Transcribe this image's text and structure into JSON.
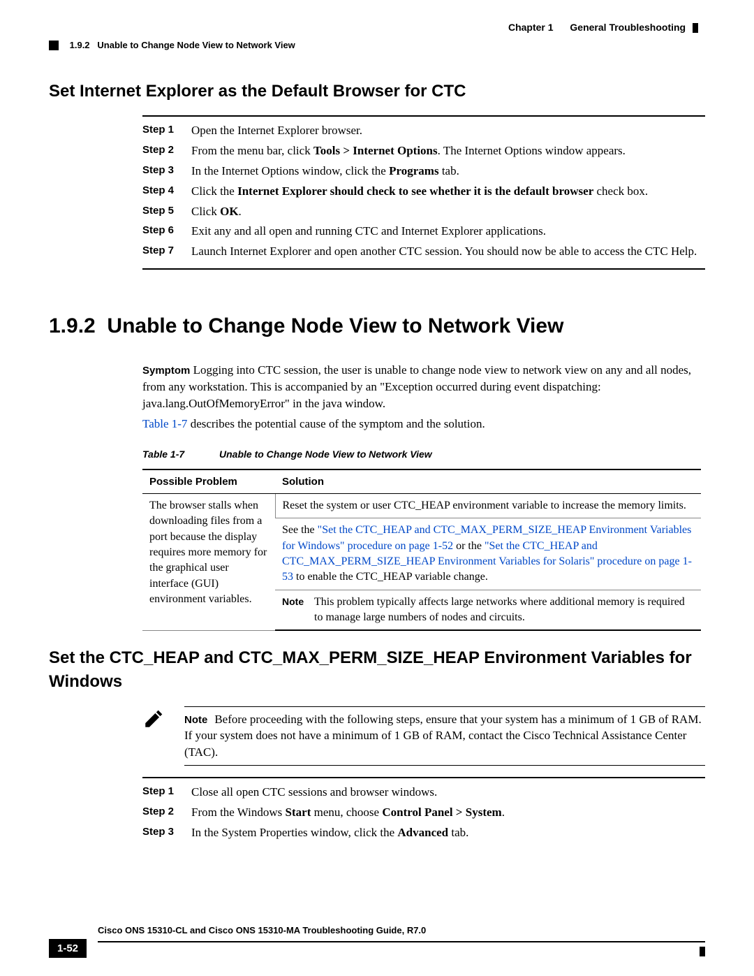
{
  "header": {
    "chapter": "Chapter 1",
    "section": "General Troubleshooting",
    "subsec_num": "1.9.2",
    "subsec_title": "Unable to Change Node View to Network View"
  },
  "h2_first": "Set Internet Explorer as the Default Browser for CTC",
  "steps1": {
    "s1": {
      "label": "Step 1",
      "text": "Open the Internet Explorer browser."
    },
    "s2": {
      "label": "Step 2",
      "a": "From the menu bar, click ",
      "b": "Tools > Internet Options",
      "c": ". The Internet Options window appears."
    },
    "s3": {
      "label": "Step 3",
      "a": "In the Internet Options window, click the ",
      "b": "Programs",
      "c": " tab."
    },
    "s4": {
      "label": "Step 4",
      "a": "Click the ",
      "b": "Internet Explorer should check to see whether it is the default browser",
      "c": " check box."
    },
    "s5": {
      "label": "Step 5",
      "a": "Click ",
      "b": "OK",
      "c": "."
    },
    "s6": {
      "label": "Step 6",
      "text": "Exit any and all open and running CTC and Internet Explorer applications."
    },
    "s7": {
      "label": "Step 7",
      "text": "Launch Internet Explorer and open another CTC session. You should now be able to access the CTC Help."
    }
  },
  "big_section": {
    "num": "1.9.2",
    "title": "Unable to Change Node View to Network View"
  },
  "symptom": {
    "label": "Symptom",
    "text": "   Logging into CTC session, the user is unable to change node view to network view on any and all nodes, from any workstation. This is accompanied by an \"Exception occurred during event dispatching: java.lang.OutOfMemoryError\" in the java window."
  },
  "desc_link": "Table 1-7",
  "desc_after": " describes the potential cause of the symptom and the solution.",
  "table": {
    "num": "Table 1-7",
    "title": "Unable to Change Node View to Network View",
    "h1": "Possible Problem",
    "h2": "Solution",
    "problem": "The browser stalls when downloading files from a port because the display requires more memory for the graphical user interface (GUI) environment variables.",
    "sol1": "Reset the system or user CTC_HEAP environment variable to increase the memory limits.",
    "sol2_a": "See the ",
    "sol2_link1": "\"Set the CTC_HEAP and CTC_MAX_PERM_SIZE_HEAP Environment Variables for Windows\" procedure on page 1-52",
    "sol2_b": " or the ",
    "sol2_link2": "\"Set the CTC_HEAP and CTC_MAX_PERM_SIZE_HEAP Environment Variables for Solaris\" procedure on page 1-53",
    "sol2_c": " to enable the CTC_HEAP variable change.",
    "note_label": "Note",
    "note_text": "This problem typically affects large networks where additional memory is required to manage large numbers of nodes and circuits."
  },
  "h2_second": "Set the CTC_HEAP and CTC_MAX_PERM_SIZE_HEAP Environment Variables for Windows",
  "note2": {
    "label": "Note",
    "text": "Before proceeding with the following steps, ensure that your system has a minimum of 1 GB of RAM. If your system does not have a minimum of 1 GB of RAM, contact the Cisco Technical Assistance Center (TAC)."
  },
  "steps2": {
    "s1": {
      "label": "Step 1",
      "text": "Close all open CTC sessions and browser windows."
    },
    "s2": {
      "label": "Step 2",
      "a": "From the Windows ",
      "b": "Start",
      "c": " menu, choose ",
      "d": "Control Panel > System",
      "e": "."
    },
    "s3": {
      "label": "Step 3",
      "a": "In the System Properties window, click the ",
      "b": "Advanced",
      "c": " tab."
    }
  },
  "footer": {
    "title": "Cisco ONS 15310-CL and Cisco ONS 15310-MA Troubleshooting Guide, R7.0",
    "page": "1-52"
  }
}
